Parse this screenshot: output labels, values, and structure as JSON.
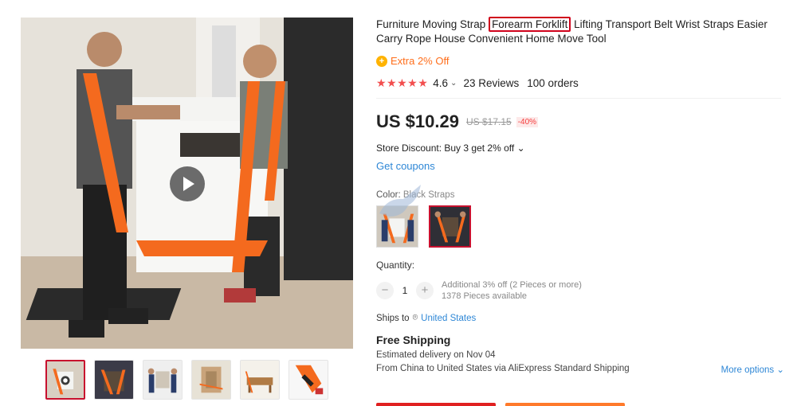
{
  "product": {
    "title_before": "Furniture Moving Strap ",
    "title_highlight": "Forearm Forklift",
    "title_after": " Lifting Transport Belt Wrist Straps Easier Carry Rope House Convenient Home Move Tool",
    "extra_offer": "Extra 2% Off",
    "rating": "4.6",
    "reviews": "23 Reviews",
    "orders": "100 orders",
    "price": "US $10.29",
    "old_price": "US $17.15",
    "discount": "-40%",
    "store_discount": "Store Discount: Buy 3 get 2% off",
    "coupons": "Get coupons",
    "color_label": "Color:",
    "color_value": "Black Straps",
    "quantity_label": "Quantity:",
    "quantity_value": "1",
    "qty_note_1": "Additional 3% off (2 Pieces or more)",
    "qty_note_2": "1378 Pieces available",
    "ships_to_label": "Ships to",
    "ships_to_country": "United States",
    "free_shipping": "Free Shipping",
    "delivery": "Estimated delivery on Nov 04",
    "from_text": "From China to United States via AliExpress Standard Shipping",
    "more_options": "More options"
  },
  "icons": {
    "star": "★",
    "chevron": "⌄",
    "minus": "−",
    "plus": "+",
    "pin": "⌾"
  },
  "colors": {
    "accent_red": "#c8102e",
    "link_blue": "#2e87d6",
    "extra_orange": "#ff6e1b",
    "star_red": "#f24e4e"
  }
}
